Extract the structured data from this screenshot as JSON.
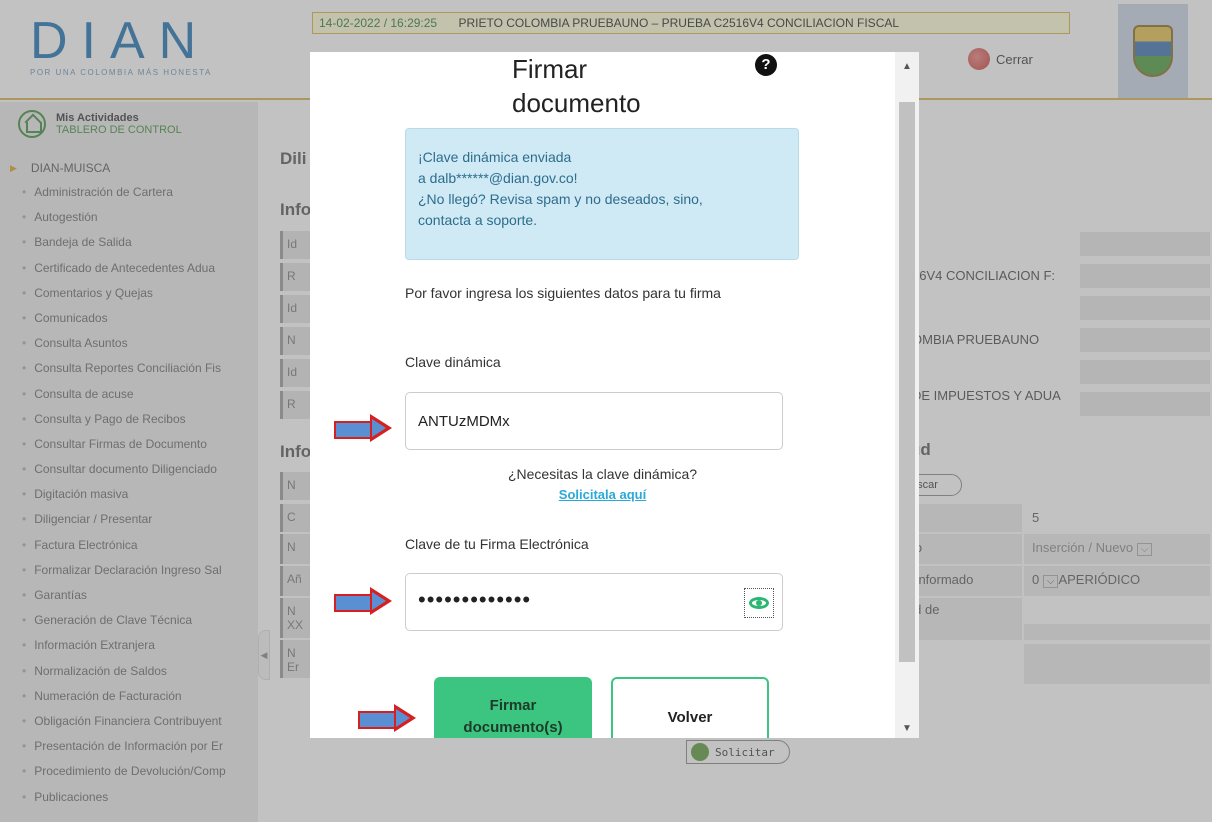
{
  "header": {
    "logo_text": "DIAN",
    "logo_slogan": "POR UNA COLOMBIA MÁS HONESTA",
    "datetime": "14-02-2022 / 16:29:25",
    "title": "PRIETO COLOMBIA PRUEBAUNO – PRUEBA C2516V4 CONCILIACION FISCAL",
    "close_label": "Cerrar"
  },
  "sidebar": {
    "mis_actividades": "Mis Actividades",
    "tablero": "TABLERO DE CONTROL",
    "root": "DIAN-MUISCA",
    "items": [
      "Administración de Cartera",
      "Autogestión",
      "Bandeja de Salida",
      "Certificado de Antecedentes Adua",
      "Comentarios y Quejas",
      "Comunicados",
      "Consulta Asuntos",
      "Consulta Reportes Conciliación Fis",
      "Consulta de acuse",
      "Consulta y Pago de Recibos",
      "Consultar Firmas de Documento",
      "Consultar documento Diligenciado",
      "Digitación masiva",
      "Diligenciar / Presentar",
      "Factura Electrónica",
      "Formalizar Declaración Ingreso Sal",
      "Garantías",
      "Generación de Clave Técnica",
      "Información Extranjera",
      "Normalización de Saldos",
      "Numeración de Facturación",
      "Obligación Financiera Contribuyent",
      "Presentación de Información por Er",
      "Procedimiento de Devolución/Comp",
      "Publicaciones"
    ]
  },
  "content": {
    "title_diligenciar": "Dili",
    "title_info1": "Info",
    "title_info2": "Info",
    "title_ud": "ud",
    "left_cells_1": [
      "Id",
      "R",
      "Id",
      "N",
      "Id",
      "R"
    ],
    "left_cells_2": [
      "N",
      "C",
      "N",
      "Añ",
      "N\nXX",
      "N\nEr"
    ],
    "right_rows": [
      "16V4 CONCILIACION F:",
      "OMBIA PRUEBAUNO",
      "DE IMPUESTOS Y ADUA"
    ],
    "buscar": "uscar",
    "grid": {
      "r1_label": "n",
      "r1_value": "5",
      "r2_label": "pto",
      "r2_value": "Inserción / Nuevo",
      "r3_label": "o Informado",
      "r3_value": "0",
      "r3_value2": "APERIÓDICO",
      "r4_label": "lad de\nos"
    },
    "solicitar": "Solicitar"
  },
  "modal": {
    "title": "Firmar documento",
    "info_lines": [
      "¡Clave dinámica enviada",
      "a dalb******@dian.gov.co!",
      "¿No llegó? Revisa spam y no deseados, sino,",
      "contacta a soporte."
    ],
    "instructions": "Por favor ingresa los siguientes datos para tu firma",
    "clave_dinamica_label": "Clave dinámica",
    "clave_dinamica_value": "ANTUzMDMx",
    "need_key_text": "¿Necesitas la clave dinámica?",
    "request_link": "Solicitala aquí",
    "firma_label": "Clave de tu Firma Electrónica",
    "firma_value": "•••••••••••••",
    "sign_button": "Firmar documento(s)",
    "back_button": "Volver"
  }
}
